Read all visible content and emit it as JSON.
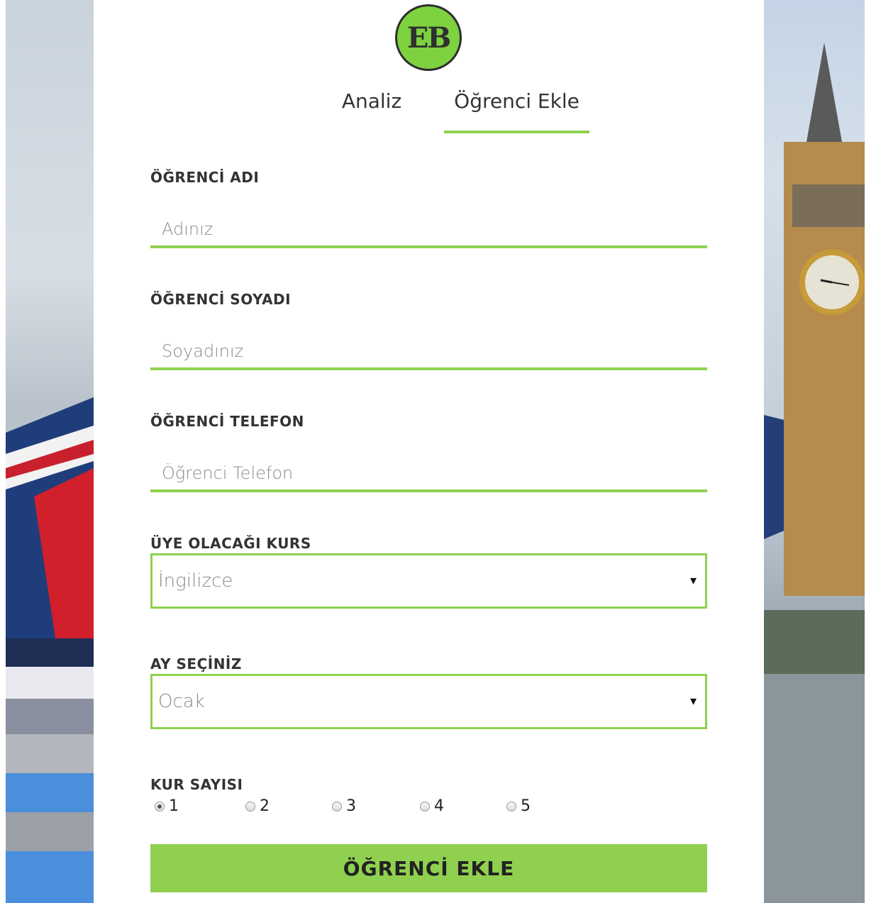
{
  "logo": {
    "text": "EB"
  },
  "tabs": [
    {
      "label": "Analiz"
    },
    {
      "label": "Öğrenci Ekle",
      "active": true
    }
  ],
  "form": {
    "name": {
      "label": "ÖĞRENCİ ADI",
      "placeholder": "Adınız",
      "value": ""
    },
    "surname": {
      "label": "ÖĞRENCİ SOYADI",
      "placeholder": "Soyadınız",
      "value": ""
    },
    "phone": {
      "label": "ÖĞRENCİ TELEFON",
      "placeholder": "Öğrenci Telefon",
      "value": ""
    },
    "course": {
      "label": "ÜYE OLACAĞI KURS",
      "selected": "İngilizce"
    },
    "month": {
      "label": "AY SEÇİNİZ",
      "selected": "Ocak"
    },
    "level": {
      "label": "KUR SAYISI",
      "options": [
        "1",
        "2",
        "3",
        "4",
        "5"
      ],
      "selected": "1"
    },
    "submit_label": "ÖĞRENCİ EKLE"
  },
  "colors": {
    "accent": "#8fd14f",
    "logo_fill": "#7ed13f",
    "text": "#333333"
  },
  "icons": {
    "select_arrow": "▾"
  }
}
